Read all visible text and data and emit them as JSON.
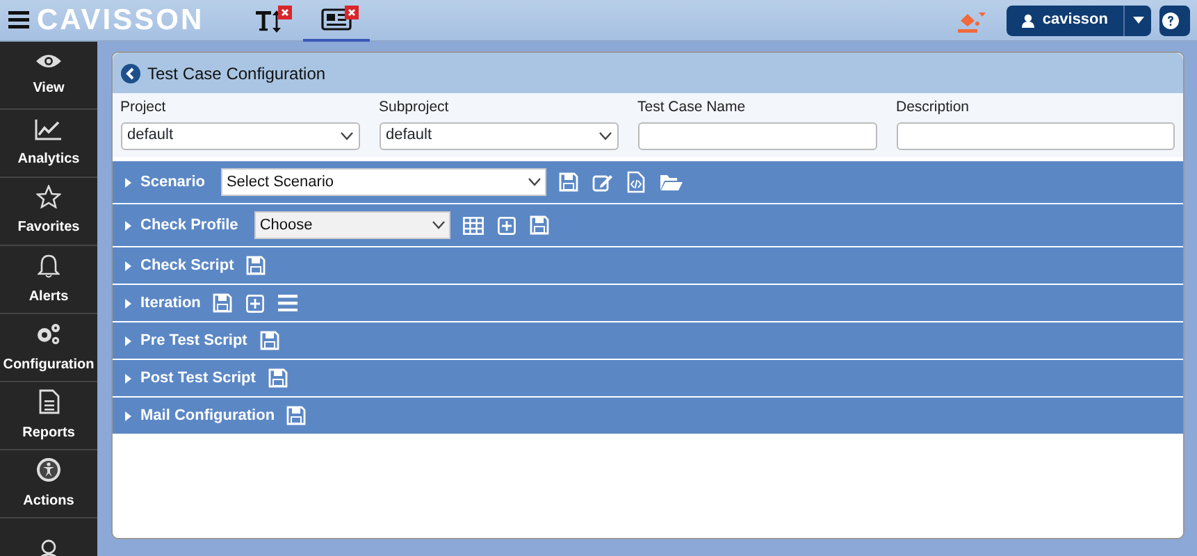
{
  "header": {
    "logo": "CAVISSON",
    "tabs": [
      {
        "kind": "text-size",
        "selected": false
      },
      {
        "kind": "news",
        "selected": true
      }
    ],
    "user": "cavisson"
  },
  "sidebar": {
    "items": [
      {
        "kind": "eye",
        "label": "View"
      },
      {
        "kind": "chart",
        "label": "Analytics"
      },
      {
        "kind": "star",
        "label": "Favorites"
      },
      {
        "kind": "bell",
        "label": "Alerts"
      },
      {
        "kind": "gears",
        "label": "Configuration"
      },
      {
        "kind": "doc",
        "label": "Reports"
      },
      {
        "kind": "person",
        "label": "Actions"
      },
      {
        "kind": "user"
      }
    ]
  },
  "panel": {
    "title": "Test Case Configuration",
    "fields": [
      {
        "kind": "select",
        "label": "Project",
        "value": "default"
      },
      {
        "kind": "select",
        "label": "Subproject",
        "value": "default"
      },
      {
        "kind": "input",
        "label": "Test Case Name"
      },
      {
        "kind": "input",
        "label": "Description"
      }
    ],
    "sections": [
      {
        "label": "Scenario",
        "expanded": false,
        "dropdown": {
          "value": "Select Scenario",
          "kind": "white"
        },
        "tools": [
          {
            "kind": "save"
          },
          {
            "kind": "edit"
          },
          {
            "kind": "code"
          },
          {
            "kind": "folder"
          }
        ]
      },
      {
        "label": "Check Profile",
        "expanded": false,
        "dropdown": {
          "value": "Choose",
          "kind": "grey"
        },
        "tools": [
          {
            "kind": "grid"
          },
          {
            "kind": "plus"
          },
          {
            "kind": "save"
          }
        ]
      },
      {
        "label": "Check Script",
        "expanded": false,
        "tools": [
          {
            "kind": "save"
          }
        ]
      },
      {
        "label": "Iteration",
        "expanded": false,
        "tools": [
          {
            "kind": "save"
          },
          {
            "kind": "plus"
          },
          {
            "kind": "list"
          }
        ]
      },
      {
        "label": "Pre Test Script",
        "expanded": false,
        "tools": [
          {
            "kind": "save"
          }
        ]
      },
      {
        "label": "Post Test Script",
        "expanded": false,
        "tools": [
          {
            "kind": "save"
          }
        ]
      },
      {
        "label": "Mail Configuration",
        "expanded": false,
        "tools": [
          {
            "kind": "save"
          }
        ]
      }
    ]
  }
}
